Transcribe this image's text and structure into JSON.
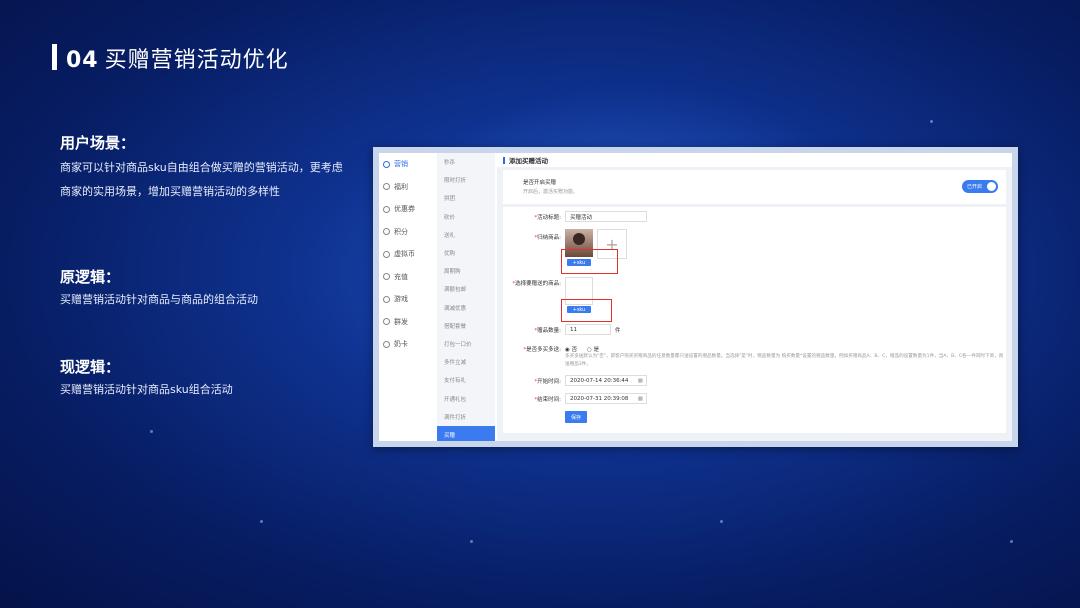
{
  "slide": {
    "number": "04",
    "title": "买赠营销活动优化"
  },
  "sections": [
    {
      "heading": "用户场景：",
      "text": "商家可以针对商品sku自由组合做买赠的营销活动，更考虑商家的实用场景，增加买赠营销活动的多样性"
    },
    {
      "heading": "原逻辑：",
      "text": "买赠营销活动针对商品与商品的组合活动"
    },
    {
      "heading": "现逻辑：",
      "text": "买赠营销活动针对商品sku组合活动"
    }
  ],
  "screenshot": {
    "primary_nav": [
      {
        "label": "营销",
        "icon": "marketing-icon",
        "active": true
      },
      {
        "label": "福利",
        "icon": "gift-icon"
      },
      {
        "label": "优惠券",
        "icon": "coupon-icon"
      },
      {
        "label": "积分",
        "icon": "points-icon"
      },
      {
        "label": "虚拟币",
        "icon": "coin-icon"
      },
      {
        "label": "充值",
        "icon": "recharge-icon"
      },
      {
        "label": "游戏",
        "icon": "game-icon"
      },
      {
        "label": "群发",
        "icon": "broadcast-icon"
      },
      {
        "label": "奶卡",
        "icon": "card-icon"
      }
    ],
    "secondary_nav": [
      {
        "label": "秒杀"
      },
      {
        "label": "限时打折"
      },
      {
        "label": "拼团"
      },
      {
        "label": "砍价"
      },
      {
        "label": "送礼"
      },
      {
        "label": "优购"
      },
      {
        "label": "周期购"
      },
      {
        "label": "满额包邮"
      },
      {
        "label": "满减优惠"
      },
      {
        "label": "搭配套餐"
      },
      {
        "label": "打包一口价"
      },
      {
        "label": "多件立减"
      },
      {
        "label": "支付有礼"
      },
      {
        "label": "开通礼包"
      },
      {
        "label": "满件打折"
      },
      {
        "label": "买赠",
        "active": true
      }
    ],
    "page_header": "添加买赠活动",
    "enable": {
      "title": "是否开启买赠",
      "desc": "开启后，激活买赠功能。",
      "toggle_label": "已开启"
    },
    "form": {
      "activity_name_label": "活动标题:",
      "activity_name_value": "买赠活动",
      "goods_label": "归纳商品:",
      "sku_button": "+sku",
      "gift_label": "选择要赠送的商品:",
      "gift_sku_button": "+sku",
      "gift_qty_label": "赠品数量:",
      "gift_qty_value": "11",
      "gift_qty_unit": "件",
      "multi_label": "是否多买多送:",
      "multi_options": [
        "否",
        "是"
      ],
      "multi_selected": "否",
      "multi_desc": "多买多送默认为\"否\"，即客户购买买赠商品的任意数量都只送设置的赠品数量。当选择\"是\"时，赠品数量为 购买数量*设置的赠品数量。例如买赠商品A、B、C，赠品的设置数量为1件，当A、B、C各一件同时下单，则送赠品3件。",
      "start_label": "开始时间:",
      "start_value": "2020-07-14 20:36:44",
      "end_label": "结束时间:",
      "end_value": "2020-07-31 20:39:08",
      "save_button": "保存"
    }
  },
  "colors": {
    "accent": "#3a7bf0",
    "highlight_box": "#e3302f",
    "background_dark": "#071d63"
  }
}
